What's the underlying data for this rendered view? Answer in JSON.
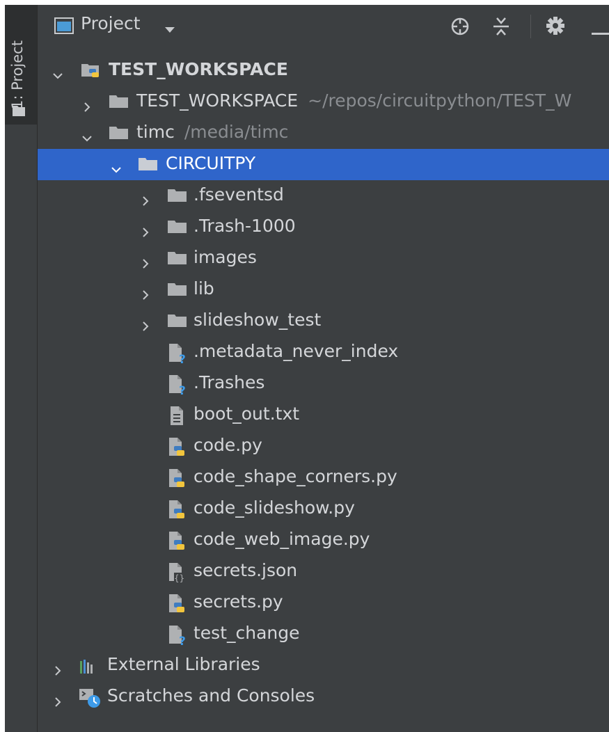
{
  "stripe": {
    "label": "1: Project"
  },
  "toolbar": {
    "title": "Project"
  },
  "tree": {
    "root": {
      "label": "TEST_WORKSPACE"
    },
    "workspace": {
      "label": "TEST_WORKSPACE",
      "path": "~/repos/circuitpython/TEST_W"
    },
    "timc": {
      "label": "timc",
      "path": "/media/timc"
    },
    "circuitpy": {
      "label": "CIRCUITPY"
    },
    "folders": [
      ".fseventsd",
      ".Trash-1000",
      "images",
      "lib",
      "slideshow_test"
    ],
    "files": [
      {
        "label": ".metadata_never_index",
        "icon": "unknown-file-icon"
      },
      {
        "label": ".Trashes",
        "icon": "unknown-file-icon"
      },
      {
        "label": "boot_out.txt",
        "icon": "text-file-icon"
      },
      {
        "label": "code.py",
        "icon": "python-file-icon"
      },
      {
        "label": "code_shape_corners.py",
        "icon": "python-file-icon"
      },
      {
        "label": "code_slideshow.py",
        "icon": "python-file-icon"
      },
      {
        "label": "code_web_image.py",
        "icon": "python-file-icon"
      },
      {
        "label": "secrets.json",
        "icon": "json-file-icon"
      },
      {
        "label": "secrets.py",
        "icon": "python-file-icon"
      },
      {
        "label": "test_change",
        "icon": "unknown-file-icon"
      }
    ],
    "external_libraries": {
      "label": "External Libraries"
    },
    "scratches": {
      "label": "Scratches and Consoles"
    }
  }
}
